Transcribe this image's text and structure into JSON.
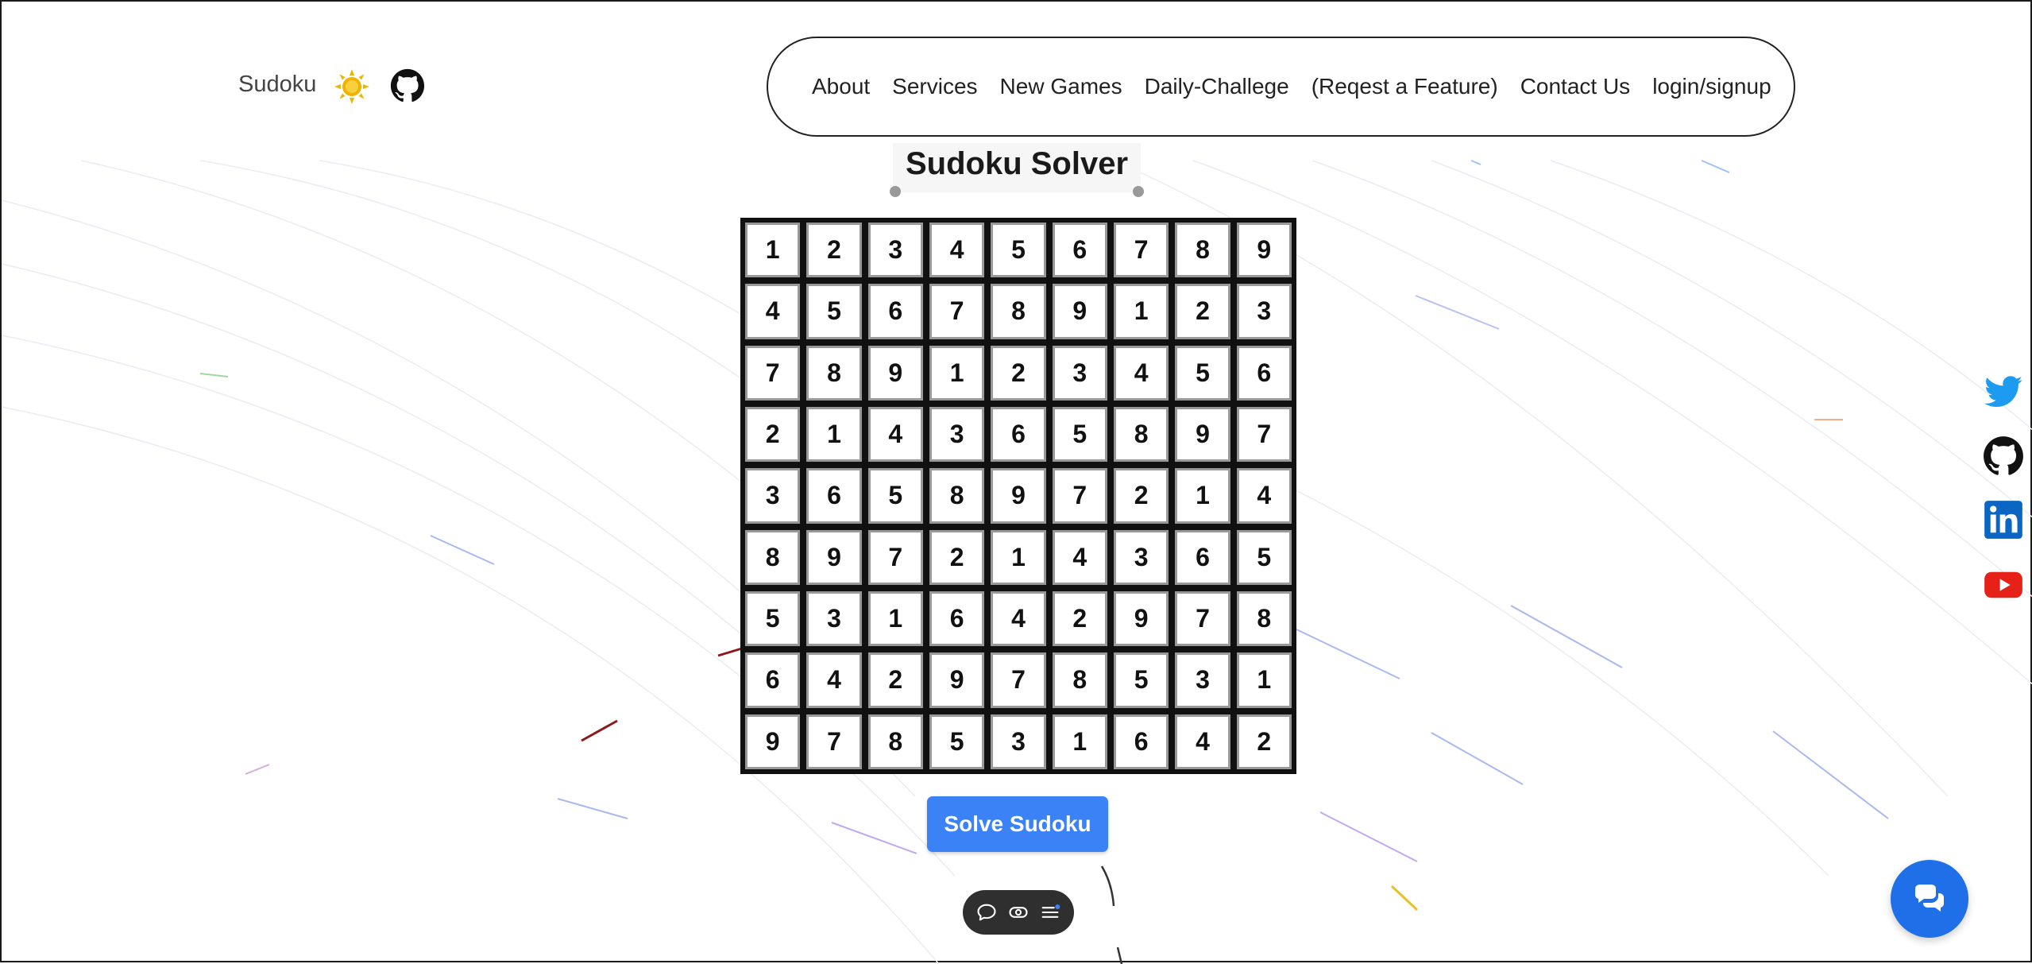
{
  "header": {
    "brand": "Sudoku",
    "nav": [
      "About",
      "Services",
      "New Games",
      "Daily-Challege",
      "(Reqest a Feature)",
      "Contact Us",
      "login/signup"
    ]
  },
  "main": {
    "title": "Sudoku Solver",
    "grid": [
      [
        "1",
        "2",
        "3",
        "4",
        "5",
        "6",
        "7",
        "8",
        "9"
      ],
      [
        "4",
        "5",
        "6",
        "7",
        "8",
        "9",
        "1",
        "2",
        "3"
      ],
      [
        "7",
        "8",
        "9",
        "1",
        "2",
        "3",
        "4",
        "5",
        "6"
      ],
      [
        "2",
        "1",
        "4",
        "3",
        "6",
        "5",
        "8",
        "9",
        "7"
      ],
      [
        "3",
        "6",
        "5",
        "8",
        "9",
        "7",
        "2",
        "1",
        "4"
      ],
      [
        "8",
        "9",
        "7",
        "2",
        "1",
        "4",
        "3",
        "6",
        "5"
      ],
      [
        "5",
        "3",
        "1",
        "6",
        "4",
        "2",
        "9",
        "7",
        "8"
      ],
      [
        "6",
        "4",
        "2",
        "9",
        "7",
        "8",
        "5",
        "3",
        "1"
      ],
      [
        "9",
        "7",
        "8",
        "5",
        "3",
        "1",
        "6",
        "4",
        "2"
      ]
    ],
    "solve_label": "Solve Sudoku"
  },
  "toolbar": {
    "icons": [
      "comment-icon",
      "eye-icon",
      "menu-icon"
    ]
  },
  "social": {
    "icons": [
      "twitter-icon",
      "github-icon",
      "linkedin-icon",
      "youtube-icon"
    ]
  },
  "colors": {
    "accent": "#3b82f6",
    "fab": "#1e6fe8",
    "sun": "#f0b400",
    "twitter": "#1d9bf0",
    "linkedin": "#0a66c2",
    "youtube": "#e62117"
  }
}
